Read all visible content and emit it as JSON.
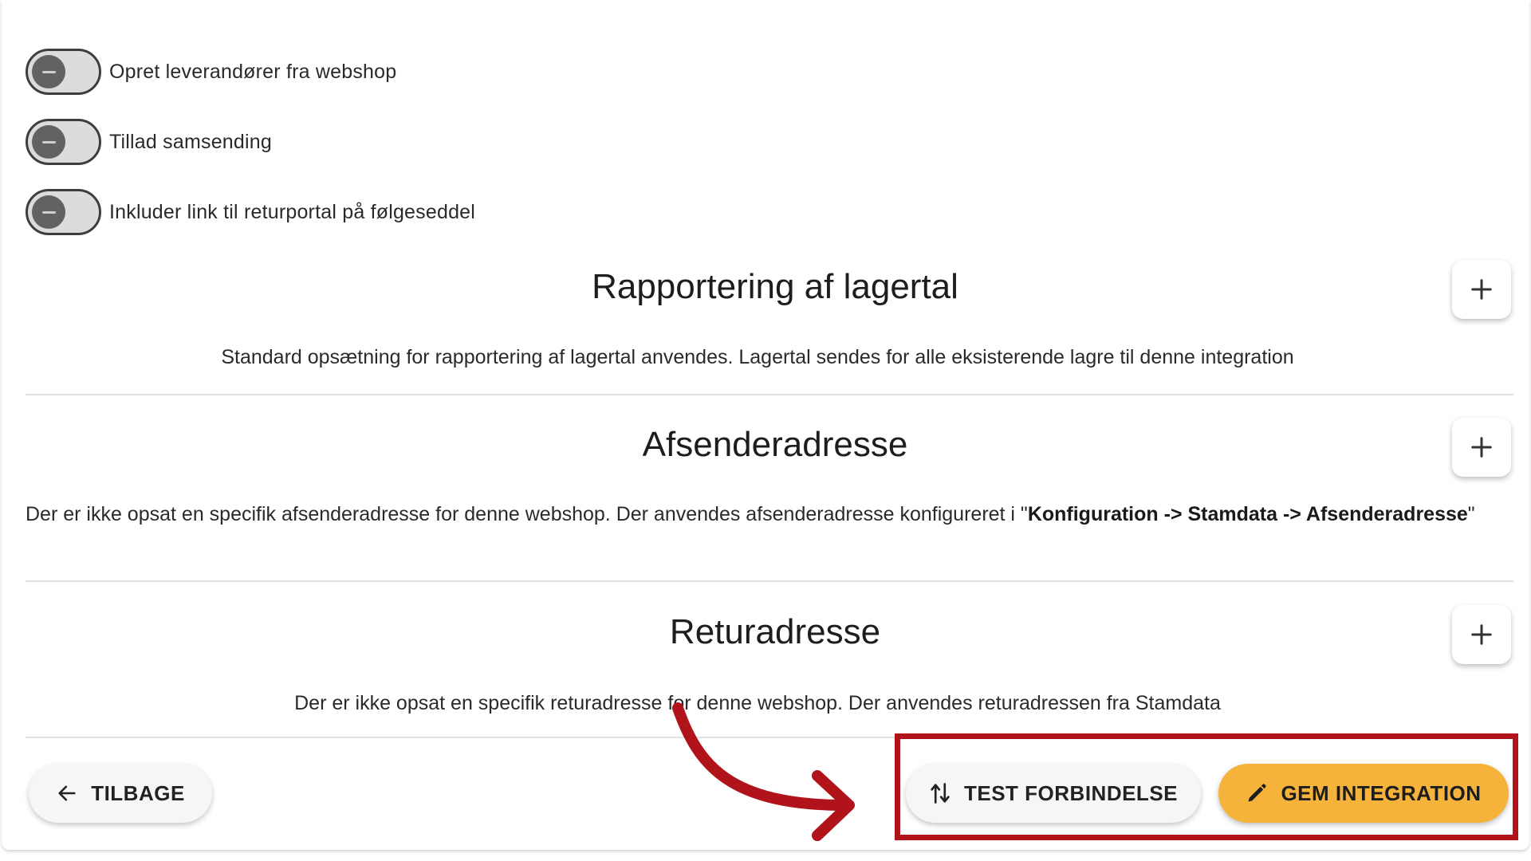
{
  "toggles": [
    {
      "label": "Opret leverandører fra webshop",
      "state": "off"
    },
    {
      "label": "Tillad samsending",
      "state": "off"
    },
    {
      "label": "Inkluder link til returportal på følgeseddel",
      "state": "off"
    }
  ],
  "sections": [
    {
      "title": "Rapportering af lagertal",
      "text": "Standard opsætning for rapportering af lagertal anvendes. Lagertal sendes for alle eksisterende lagre til denne integration"
    },
    {
      "title": "Afsenderadresse",
      "text_before": "Der er ikke opsat en specifik afsenderadresse for denne webshop. Der anvendes afsenderadresse konfigureret i \"",
      "text_bold": "Konfiguration -> Stamdata -> Afsenderadresse",
      "text_after": "\""
    },
    {
      "title": "Returadresse",
      "text": "Der er ikke opsat en specifik returadresse for denne webshop. Der anvendes returadressen fra Stamdata"
    }
  ],
  "footer": {
    "back_label": "TILBAGE",
    "test_label": "TEST FORBINDELSE",
    "save_label": "GEM INTEGRATION"
  },
  "icons": {
    "back": "arrow-left-icon",
    "test": "swap-vert-icon",
    "save": "pencil-icon",
    "expand": "plus-icon"
  },
  "colors": {
    "save_button": "#f6b33b",
    "annotation": "#b1131a",
    "toggle_off_knob": "#626262"
  }
}
